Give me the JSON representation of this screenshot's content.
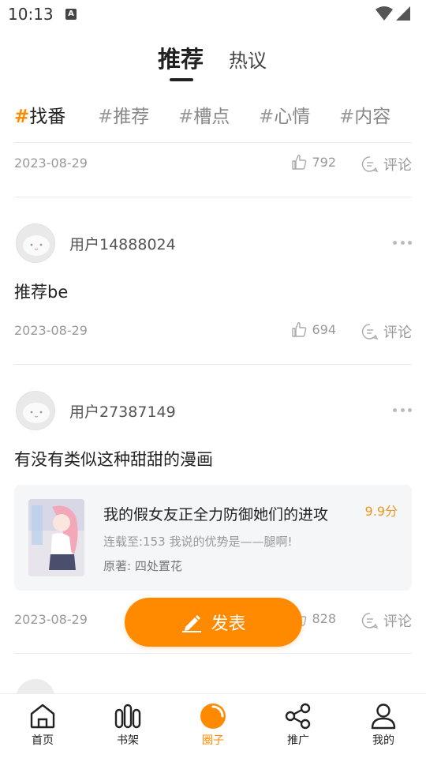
{
  "status_bar": {
    "time": "10:13"
  },
  "main_tabs": {
    "active": "推荐",
    "other": "热议"
  },
  "tags": [
    {
      "hash": "#",
      "label": "找番"
    },
    {
      "hash": "#",
      "label": "推荐"
    },
    {
      "hash": "#",
      "label": "槽点"
    },
    {
      "hash": "#",
      "label": "心情"
    },
    {
      "hash": "#",
      "label": "内容"
    }
  ],
  "posts": [
    {
      "date": "2023-08-29",
      "likes": "792",
      "comment_label": "评论"
    },
    {
      "username": "用户14888024",
      "text": "推荐be",
      "date": "2023-08-29",
      "likes": "694",
      "comment_label": "评论"
    },
    {
      "username": "用户27387149",
      "text": "有没有类似这种甜甜的漫画",
      "comic": {
        "title": "我的假女友正全力防御她们的进攻",
        "score": "9.9分",
        "latest": "连载至:153 我说的优势是——腿啊!",
        "author": "原著: 四处置花"
      },
      "date": "2023-08-29",
      "likes": "828",
      "comment_label": "评论"
    }
  ],
  "fab": {
    "label": "发表"
  },
  "bottom_nav": [
    {
      "label": "首页",
      "icon": "home-icon"
    },
    {
      "label": "书架",
      "icon": "bookshelf-icon"
    },
    {
      "label": "圈子",
      "icon": "circle-icon"
    },
    {
      "label": "推广",
      "icon": "share-icon"
    },
    {
      "label": "我的",
      "icon": "profile-icon"
    }
  ],
  "colors": {
    "accent": "#ff8a00",
    "score": "#f0951a",
    "card_bg": "#f5f6f8"
  }
}
